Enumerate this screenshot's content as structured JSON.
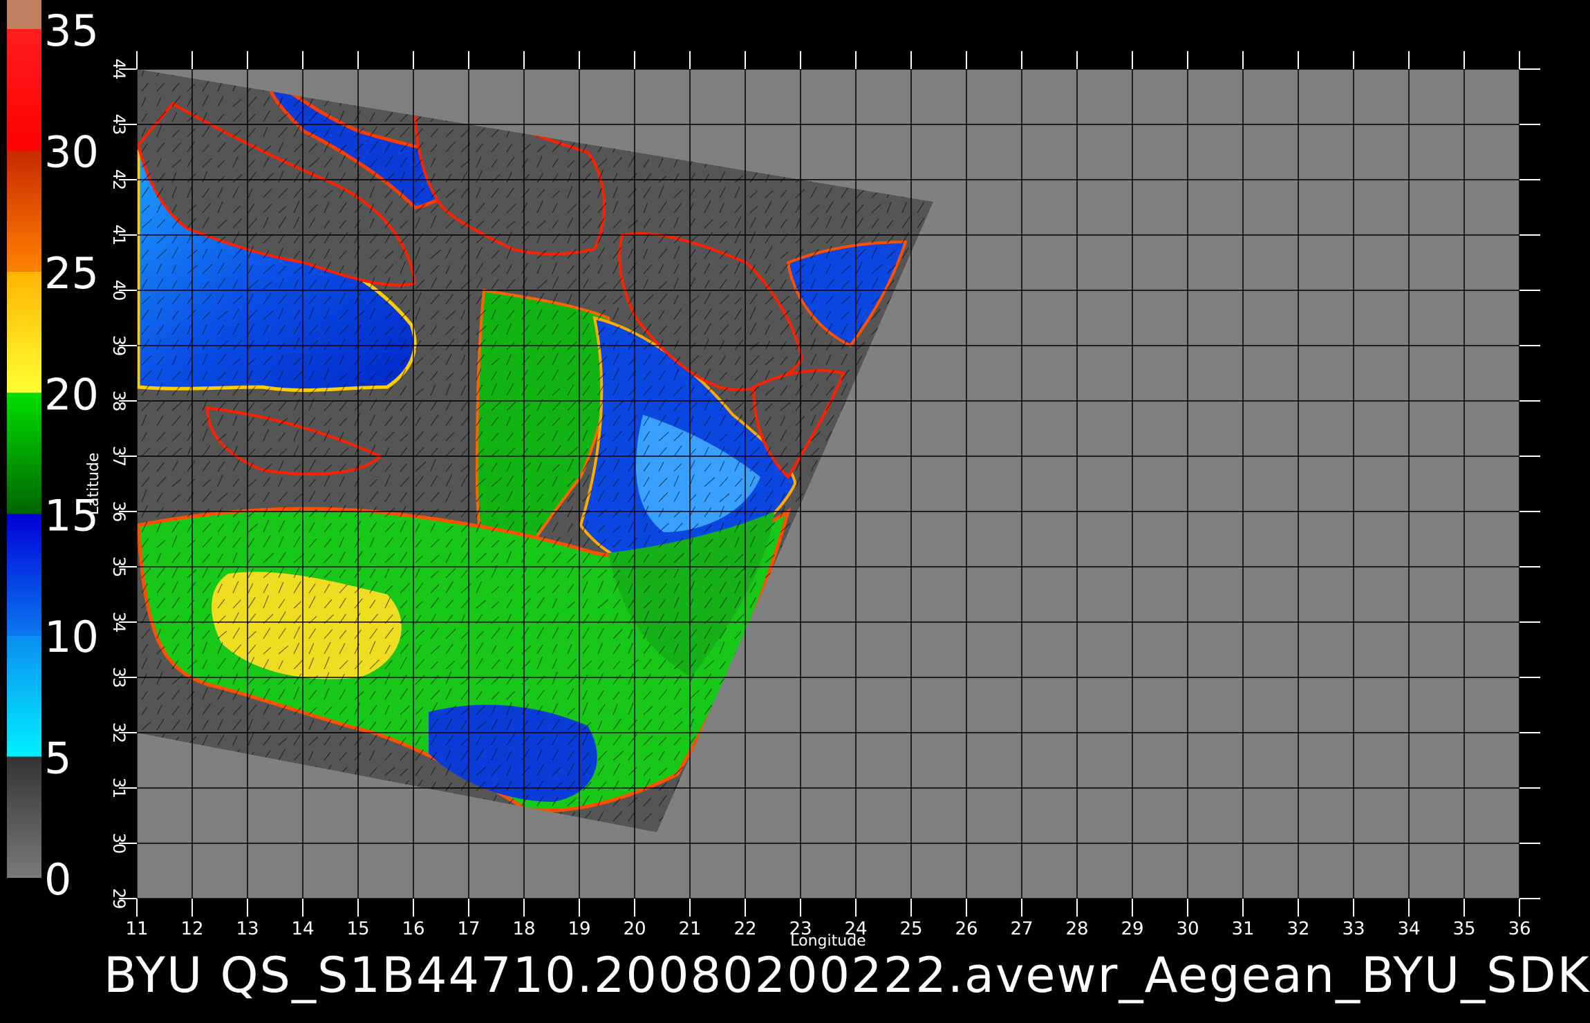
{
  "map": {
    "x_axis_label": "Longitude",
    "y_axis_label": "Latitude",
    "lon_ticks": [
      11,
      12,
      13,
      14,
      15,
      16,
      17,
      18,
      19,
      20,
      21,
      22,
      23,
      24,
      25,
      26,
      27,
      28,
      29,
      30,
      31,
      32,
      33,
      34,
      35,
      36
    ],
    "lat_ticks": [
      29,
      30,
      31,
      32,
      33,
      34,
      35,
      36,
      37,
      38,
      39,
      40,
      41,
      42,
      43,
      44
    ],
    "lon_range": [
      11,
      36
    ],
    "lat_range": [
      29,
      44
    ],
    "grid": true,
    "background_color": "#808080",
    "swath_color": "#555555",
    "swath_lonlat": [
      [
        11,
        44
      ],
      [
        25.4,
        41.6
      ],
      [
        20.4,
        30.2
      ],
      [
        11,
        32
      ]
    ]
  },
  "colorbar": {
    "ticks": [
      "0",
      "5",
      "10",
      "15",
      "20",
      "25",
      "30",
      "35"
    ],
    "values": [
      0,
      5,
      10,
      15,
      20,
      25,
      30,
      35
    ],
    "range": [
      0,
      35
    ],
    "bands": [
      {
        "from": 0,
        "to": 5,
        "color_top": "#333333",
        "color_bottom": "#7a7a7a"
      },
      {
        "from": 5,
        "to": 10,
        "color_top": "#0a8cf0",
        "color_bottom": "#00f0ff"
      },
      {
        "from": 10,
        "to": 15,
        "color_top": "#0000d8",
        "color_bottom": "#0a78f0"
      },
      {
        "from": 15,
        "to": 20,
        "color_top": "#00e000",
        "color_bottom": "#006400"
      },
      {
        "from": 20,
        "to": 25,
        "color_top": "#ffb400",
        "color_bottom": "#ffff32"
      },
      {
        "from": 25,
        "to": 30,
        "color_top": "#c82800",
        "color_bottom": "#ff8200"
      },
      {
        "from": 30,
        "to": 35,
        "color_top": "#ff1e1e",
        "color_bottom": "#ff0000"
      }
    ],
    "cap_color": "#c08060"
  },
  "caption": "BYU  QS_S1B44710.20080200222.avewr_Aegean_BYU_SDK"
}
